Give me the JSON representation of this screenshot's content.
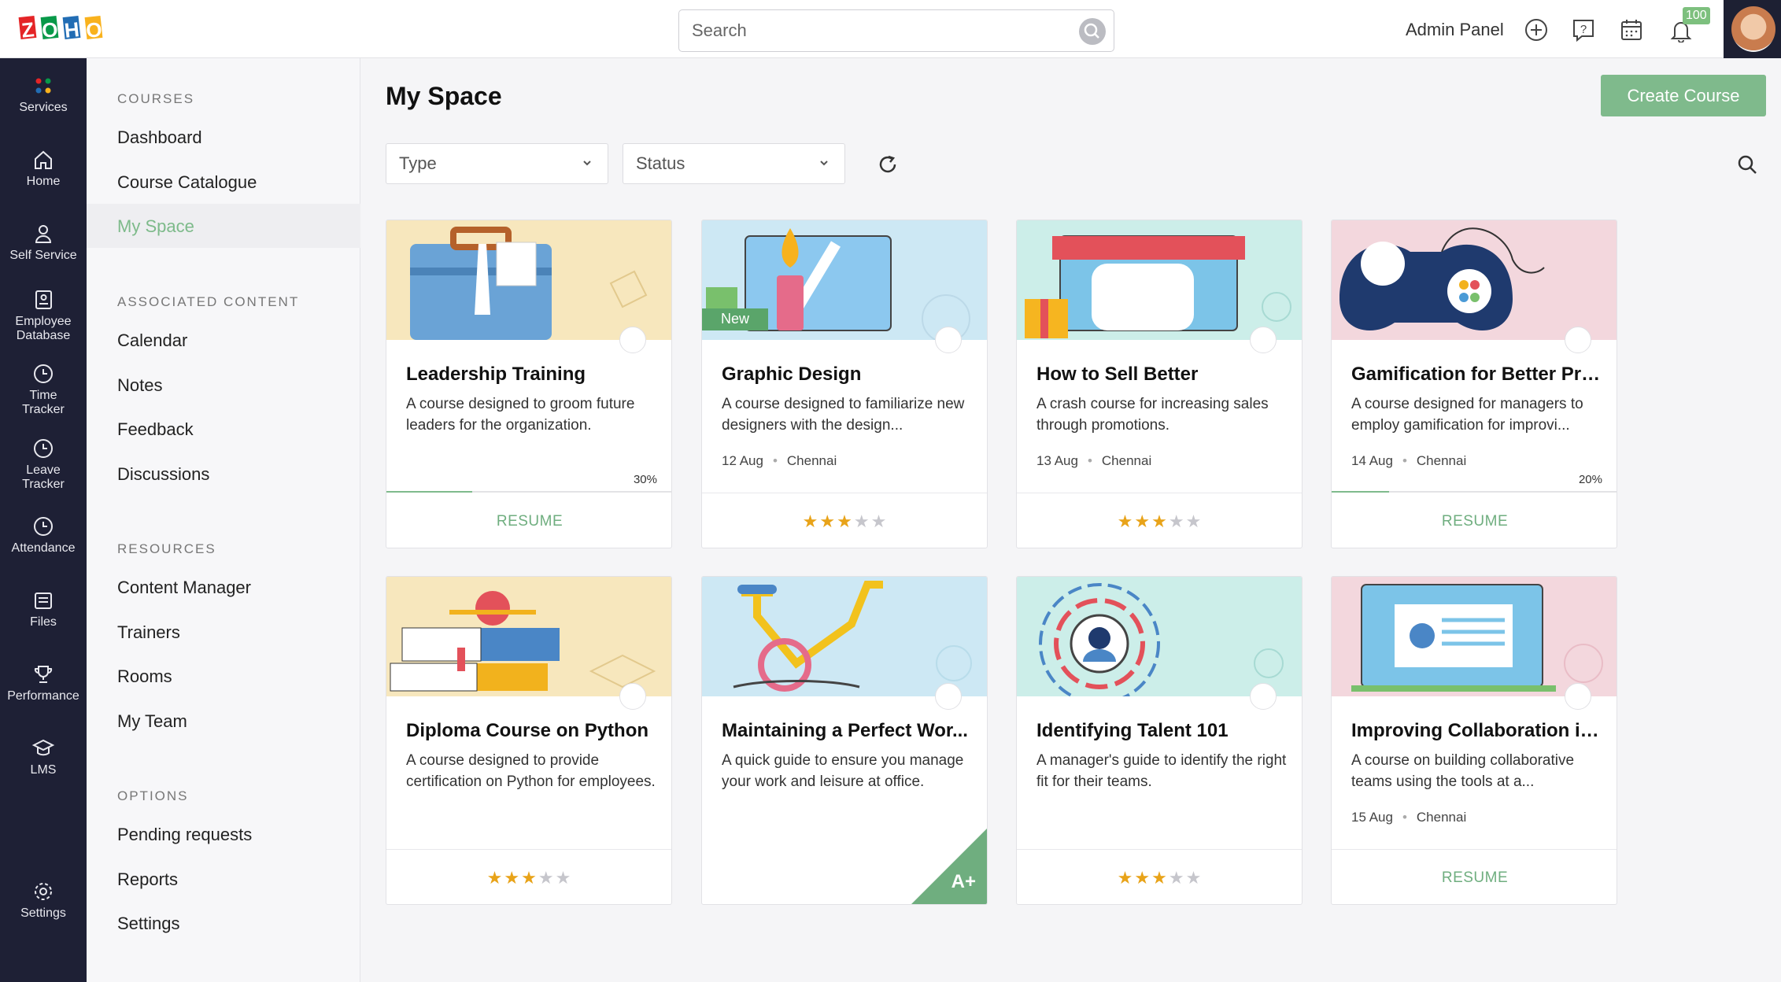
{
  "logo": {
    "letters": [
      "Z",
      "O",
      "H",
      "O"
    ],
    "colors": [
      "#e42527",
      "#089949",
      "#226db4",
      "#f9b21d"
    ]
  },
  "search": {
    "placeholder": "Search"
  },
  "header": {
    "admin_label": "Admin Panel",
    "notification_count": "100"
  },
  "leftnav": [
    {
      "label": "Services",
      "icon": "services-icon"
    },
    {
      "label": "Home",
      "icon": "home-icon"
    },
    {
      "label": "Self Service",
      "icon": "person-icon"
    },
    {
      "label": "Employee Database",
      "icon": "database-icon"
    },
    {
      "label": "Time Tracker",
      "icon": "clock-icon"
    },
    {
      "label": "Leave Tracker",
      "icon": "clock-icon"
    },
    {
      "label": "Attendance",
      "icon": "clock-icon"
    },
    {
      "label": "Files",
      "icon": "files-icon"
    },
    {
      "label": "Performance",
      "icon": "trophy-icon"
    },
    {
      "label": "LMS",
      "icon": "graduation-cap-icon"
    },
    {
      "label": "Settings",
      "icon": "gear-icon"
    }
  ],
  "submenu": {
    "courses_head": "COURSES",
    "courses": [
      "Dashboard",
      "Course Catalogue",
      "My Space"
    ],
    "associated_head": "ASSOCIATED CONTENT",
    "associated": [
      "Calendar",
      "Notes",
      "Feedback",
      "Discussions"
    ],
    "resources_head": "RESOURCES",
    "resources": [
      "Content Manager",
      "Trainers",
      "Rooms",
      "My Team"
    ],
    "options_head": "OPTIONS",
    "options": [
      "Pending requests",
      "Reports",
      "Settings"
    ]
  },
  "main": {
    "title": "My Space",
    "create_label": "Create Course",
    "type_label": "Type",
    "status_label": "Status"
  },
  "cards": [
    {
      "title": "Leadership Training",
      "desc": "A course designed to groom future leaders for the organization.",
      "progress_label": "30%",
      "progress": 0.3,
      "action": "RESUME"
    },
    {
      "title": "Graphic Design",
      "desc": "A course designed to familiarize new designers with the design...",
      "date": "12 Aug",
      "place": "Chennai",
      "badge": "New",
      "rating": 3
    },
    {
      "title": "How to Sell Better",
      "desc": "A crash course for increasing sales through promotions.",
      "date": "13 Aug",
      "place": "Chennai",
      "rating": 3
    },
    {
      "title": "Gamification for Better Pro...",
      "desc": "A course designed for managers to employ gamification for improvi...",
      "date": "14 Aug",
      "place": "Chennai",
      "progress_label": "20%",
      "progress": 0.2,
      "action": "RESUME"
    },
    {
      "title": "Diploma Course on Python",
      "desc": "A course designed to provide certification on Python for employees.",
      "rating": 3
    },
    {
      "title": "Maintaining a Perfect Wor...",
      "desc": "A quick guide to ensure you manage your work and leisure at office.",
      "grade": "A+"
    },
    {
      "title": "Identifying Talent 101",
      "desc": "A manager's guide to identify the right fit for their teams.",
      "rating": 3
    },
    {
      "title": "Improving Collaboration in ...",
      "desc": "A course on building collaborative teams using the tools at a...",
      "date": "15 Aug",
      "place": "Chennai",
      "action": "RESUME"
    }
  ],
  "colors": {
    "accent": "#7fba8c",
    "nav_bg": "#1e2035",
    "star": "#e8a319"
  }
}
